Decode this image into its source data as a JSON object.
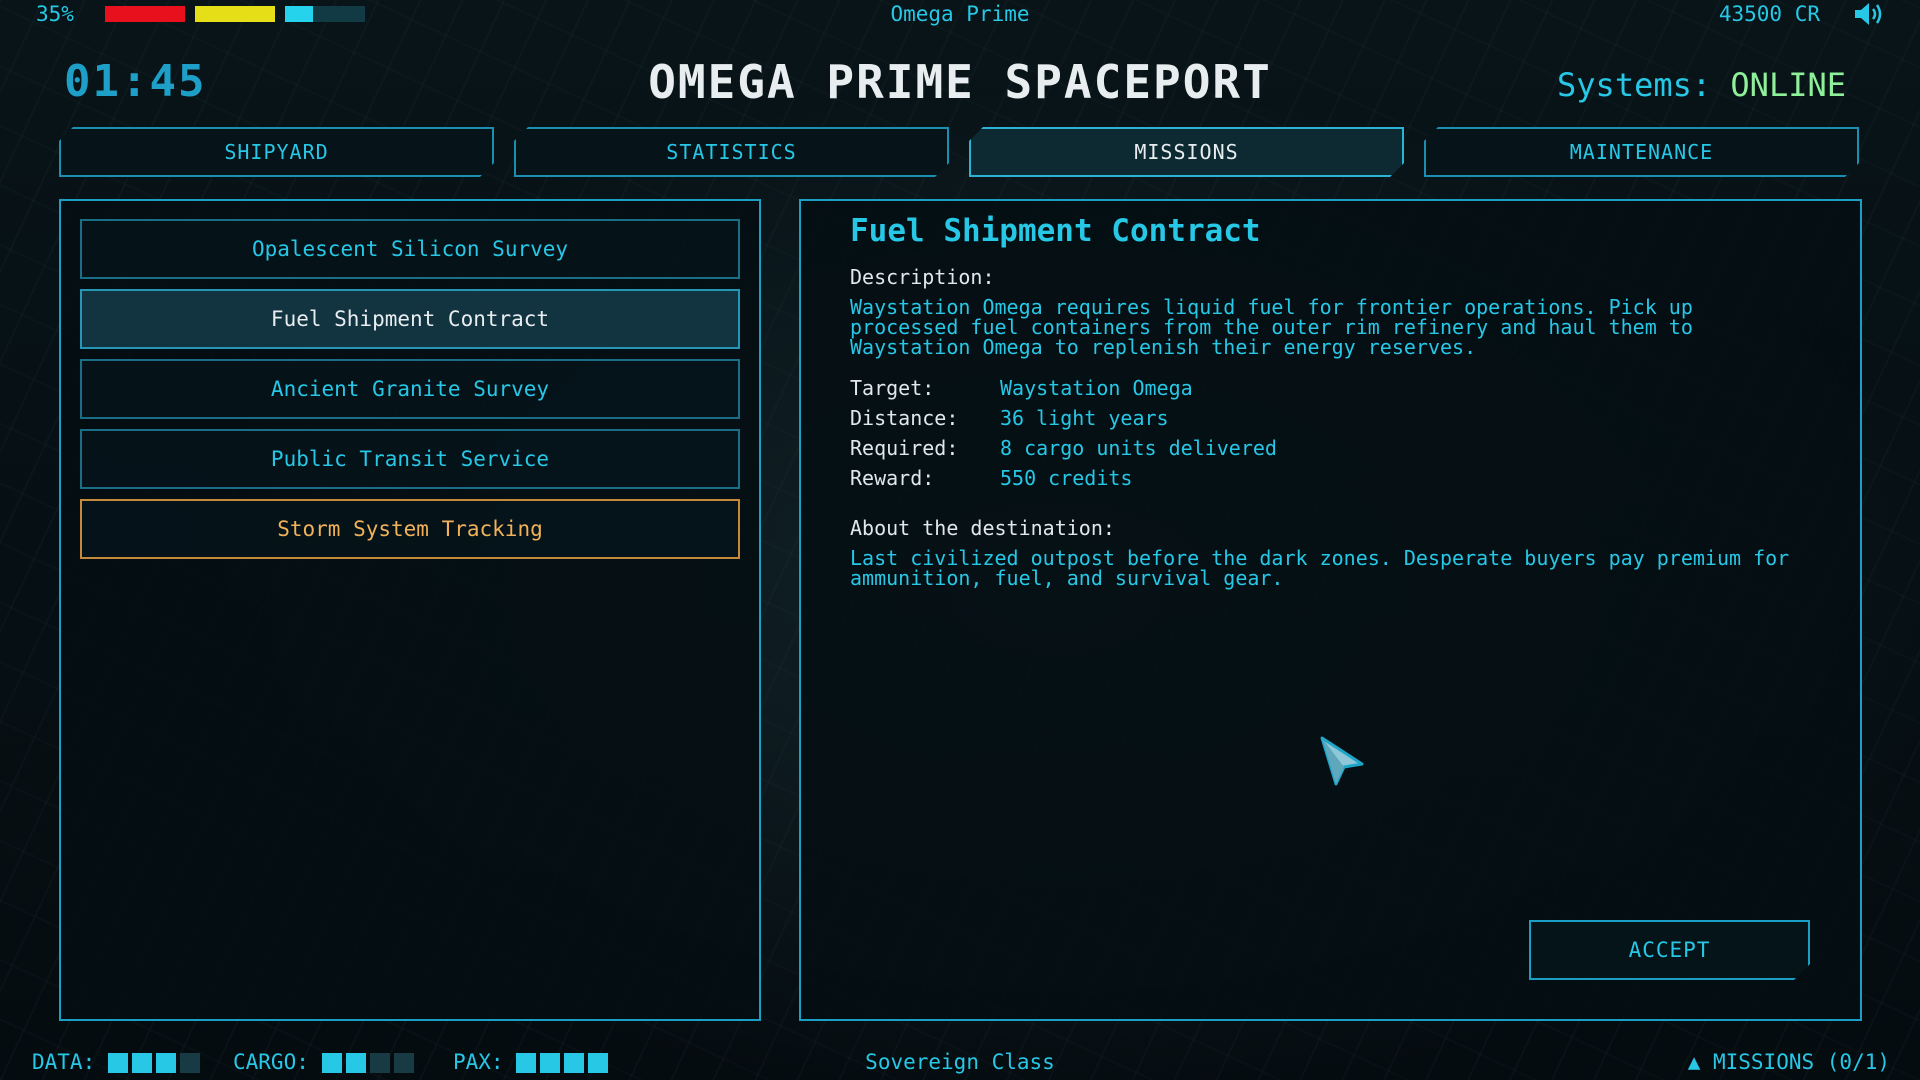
{
  "top_bar": {
    "percent": "35%",
    "location": "Omega Prime",
    "credits": "43500 CR",
    "volume_icon": "speaker-icon",
    "segments": [
      {
        "color": "#e8101c",
        "level": 1.0
      },
      {
        "color": "#e6df18",
        "level": 1.0
      },
      {
        "color": "#26d3ec",
        "level": 0.35
      }
    ]
  },
  "header": {
    "clock": "01:45",
    "title": "OMEGA PRIME SPACEPORT",
    "systems_label": "Systems:",
    "systems_status": "ONLINE"
  },
  "tabs": [
    {
      "label": "SHIPYARD",
      "active": false
    },
    {
      "label": "STATISTICS",
      "active": false
    },
    {
      "label": "MISSIONS",
      "active": true
    },
    {
      "label": "MAINTENANCE",
      "active": false
    }
  ],
  "missions": [
    {
      "label": "Opalescent Silicon Survey",
      "state": "normal"
    },
    {
      "label": "Fuel Shipment Contract",
      "state": "selected"
    },
    {
      "label": "Ancient Granite Survey",
      "state": "normal"
    },
    {
      "label": "Public Transit Service",
      "state": "normal"
    },
    {
      "label": "Storm System Tracking",
      "state": "warning"
    }
  ],
  "detail": {
    "title": "Fuel Shipment Contract",
    "description_label": "Description:",
    "description": "Waystation Omega requires liquid fuel for frontier operations. Pick up processed fuel containers from the outer rim refinery and haul them to Waystation Omega to replenish their energy reserves.",
    "target_label": "Target:",
    "target": "Waystation Omega",
    "distance_label": "Distance:",
    "distance": "36 light years",
    "required_label": "Required:",
    "required": "8 cargo units delivered",
    "reward_label": "Reward:",
    "reward": "550 credits",
    "about_label": "About the destination:",
    "about": "Last civilized outpost before the dark zones. Desperate buyers pay premium for ammunition, fuel, and survival gear.",
    "accept_label": "ACCEPT"
  },
  "bottom_bar": {
    "data_label": "DATA:",
    "data_level": [
      1,
      1,
      1,
      0
    ],
    "cargo_label": "CARGO:",
    "cargo_level": [
      1,
      1,
      0,
      0
    ],
    "pax_label": "PAX:",
    "pax_level": [
      1,
      1,
      1,
      1
    ],
    "ship_class": "Sovereign Class",
    "missions_counter": "▲ MISSIONS (0/1)"
  }
}
